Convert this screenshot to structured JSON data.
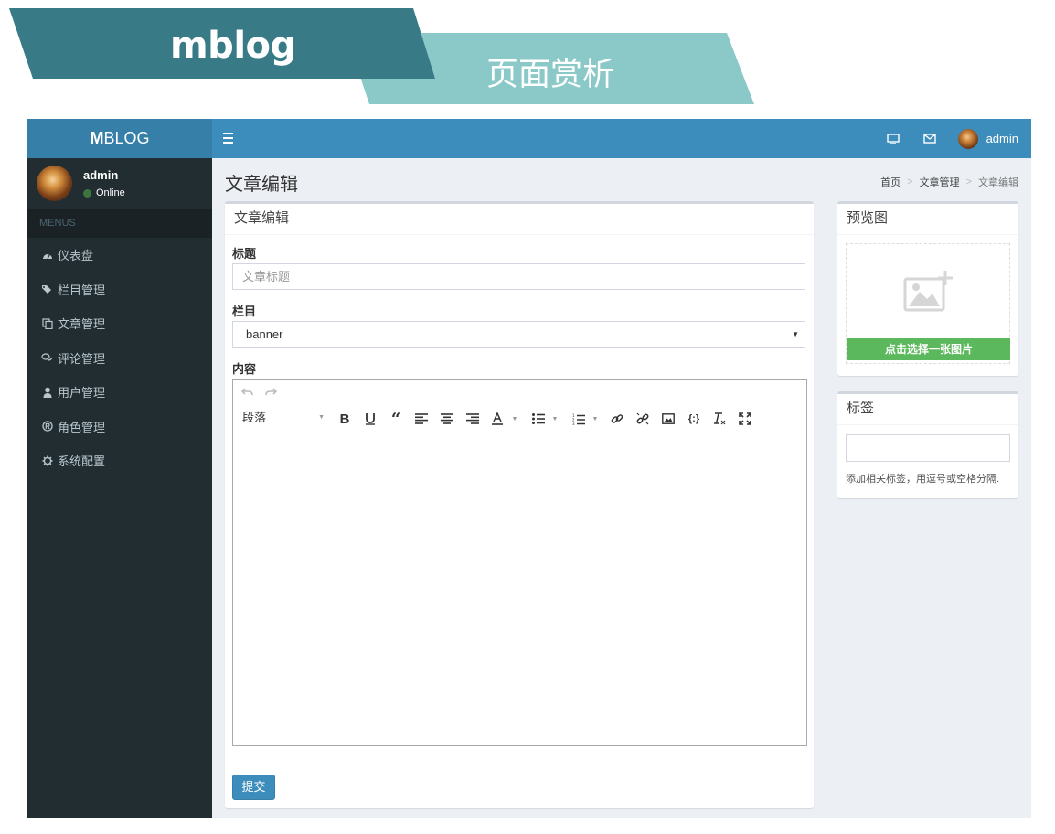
{
  "banner": {
    "title": "mblog",
    "subtitle": "页面赏析",
    "colors": {
      "dark_teal": "#387a85",
      "light_teal": "#8bc8c8"
    }
  },
  "navbar": {
    "brand_bold": "M",
    "brand_rest": "BLOG",
    "toggle_icon": "hamburger-icon",
    "icons": [
      "monitor-icon",
      "envelope-icon"
    ],
    "user_name": "admin"
  },
  "sidebar": {
    "user_name": "admin",
    "user_status": "Online",
    "menu_header": "MENUS",
    "items": [
      {
        "label": "仪表盘",
        "icon": "dashboard-icon"
      },
      {
        "label": "栏目管理",
        "icon": "tags-icon"
      },
      {
        "label": "文章管理",
        "icon": "copy-icon"
      },
      {
        "label": "评论管理",
        "icon": "comments-icon"
      },
      {
        "label": "用户管理",
        "icon": "user-icon"
      },
      {
        "label": "角色管理",
        "icon": "registered-icon"
      },
      {
        "label": "系统配置",
        "icon": "gear-icon"
      }
    ]
  },
  "content": {
    "page_title": "文章编辑",
    "breadcrumb": [
      "首页",
      "文章管理",
      "文章编辑"
    ]
  },
  "form": {
    "box_title": "文章编辑",
    "title_label": "标题",
    "title_placeholder": "文章标题",
    "category_label": "栏目",
    "category_value": "banner",
    "content_label": "内容",
    "paragraph_select": "段落",
    "submit_label": "提交"
  },
  "preview": {
    "box_title": "预览图",
    "choose_button": "点击选择一张图片"
  },
  "tags": {
    "box_title": "标签",
    "help_text": "添加相关标签，用逗号或空格分隔."
  },
  "colors": {
    "navbar": "#3c8dbc",
    "brand": "#367fa9",
    "sidebar": "#222d32",
    "content_bg": "#ecf0f5",
    "success": "#5cb85c"
  }
}
